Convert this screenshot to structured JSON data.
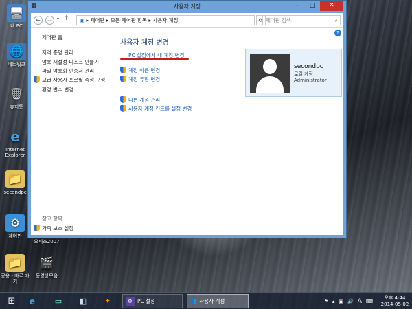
{
  "desktop": {
    "icons": [
      {
        "label": "내 PC",
        "glyph": "🖥"
      },
      {
        "label": "네트워크",
        "glyph": "🌐"
      },
      {
        "label": "휴지통",
        "glyph": "🗑"
      },
      {
        "label": "Internet Explorer",
        "glyph": "e"
      },
      {
        "label": "secondpc",
        "glyph": "📁"
      },
      {
        "label": "제어판",
        "glyph": "⚙"
      },
      {
        "label": "공용 - 바로 가기",
        "glyph": "📁"
      },
      {
        "label": "동영상모음",
        "glyph": "🎬"
      }
    ],
    "partial_label": "오피스2007"
  },
  "window": {
    "title": "사용자 계정",
    "search_placeholder": "제어판 검색",
    "breadcrumb": "▸ 제어판 ▸ 모든 제어판 항목 ▸ 사용자 계정",
    "left_nav": {
      "home": "제어판 홈",
      "links": [
        {
          "label": "자격 증명 관리",
          "shield": false
        },
        {
          "label": "암호 재설정 디스크 만들기",
          "shield": false
        },
        {
          "label": "파일 암호화 인증서 관리",
          "shield": false
        },
        {
          "label": "고급 사용자 프로필 속성 구성",
          "shield": true
        },
        {
          "label": "환경 변수 변경",
          "shield": false
        }
      ],
      "see_also_heading": "참고 항목",
      "see_also_links": [
        {
          "label": "가족 보호 설정",
          "shield": true
        }
      ]
    },
    "main": {
      "heading": "사용자 계정 변경",
      "pc_settings_link": "PC 설정에서 내 계정 변경",
      "links_group1": [
        {
          "label": "계정 이름 변경",
          "shield": true
        },
        {
          "label": "계정 유형 변경",
          "shield": true
        }
      ],
      "links_group2": [
        {
          "label": "다른 계정 관리",
          "shield": true
        },
        {
          "label": "사용자 계정 컨트롤 설정 변경",
          "shield": true
        }
      ]
    },
    "user_card": {
      "name": "secondpc",
      "account_type": "로컬 계정",
      "role": "Administrator"
    }
  },
  "taskbar": {
    "items": [
      {
        "label": "PC 설정",
        "active": false
      },
      {
        "label": "사용자 계정",
        "active": true
      }
    ],
    "tray": {
      "ime": "A",
      "time": "오후 4:44",
      "date": "2014-05-02"
    }
  }
}
